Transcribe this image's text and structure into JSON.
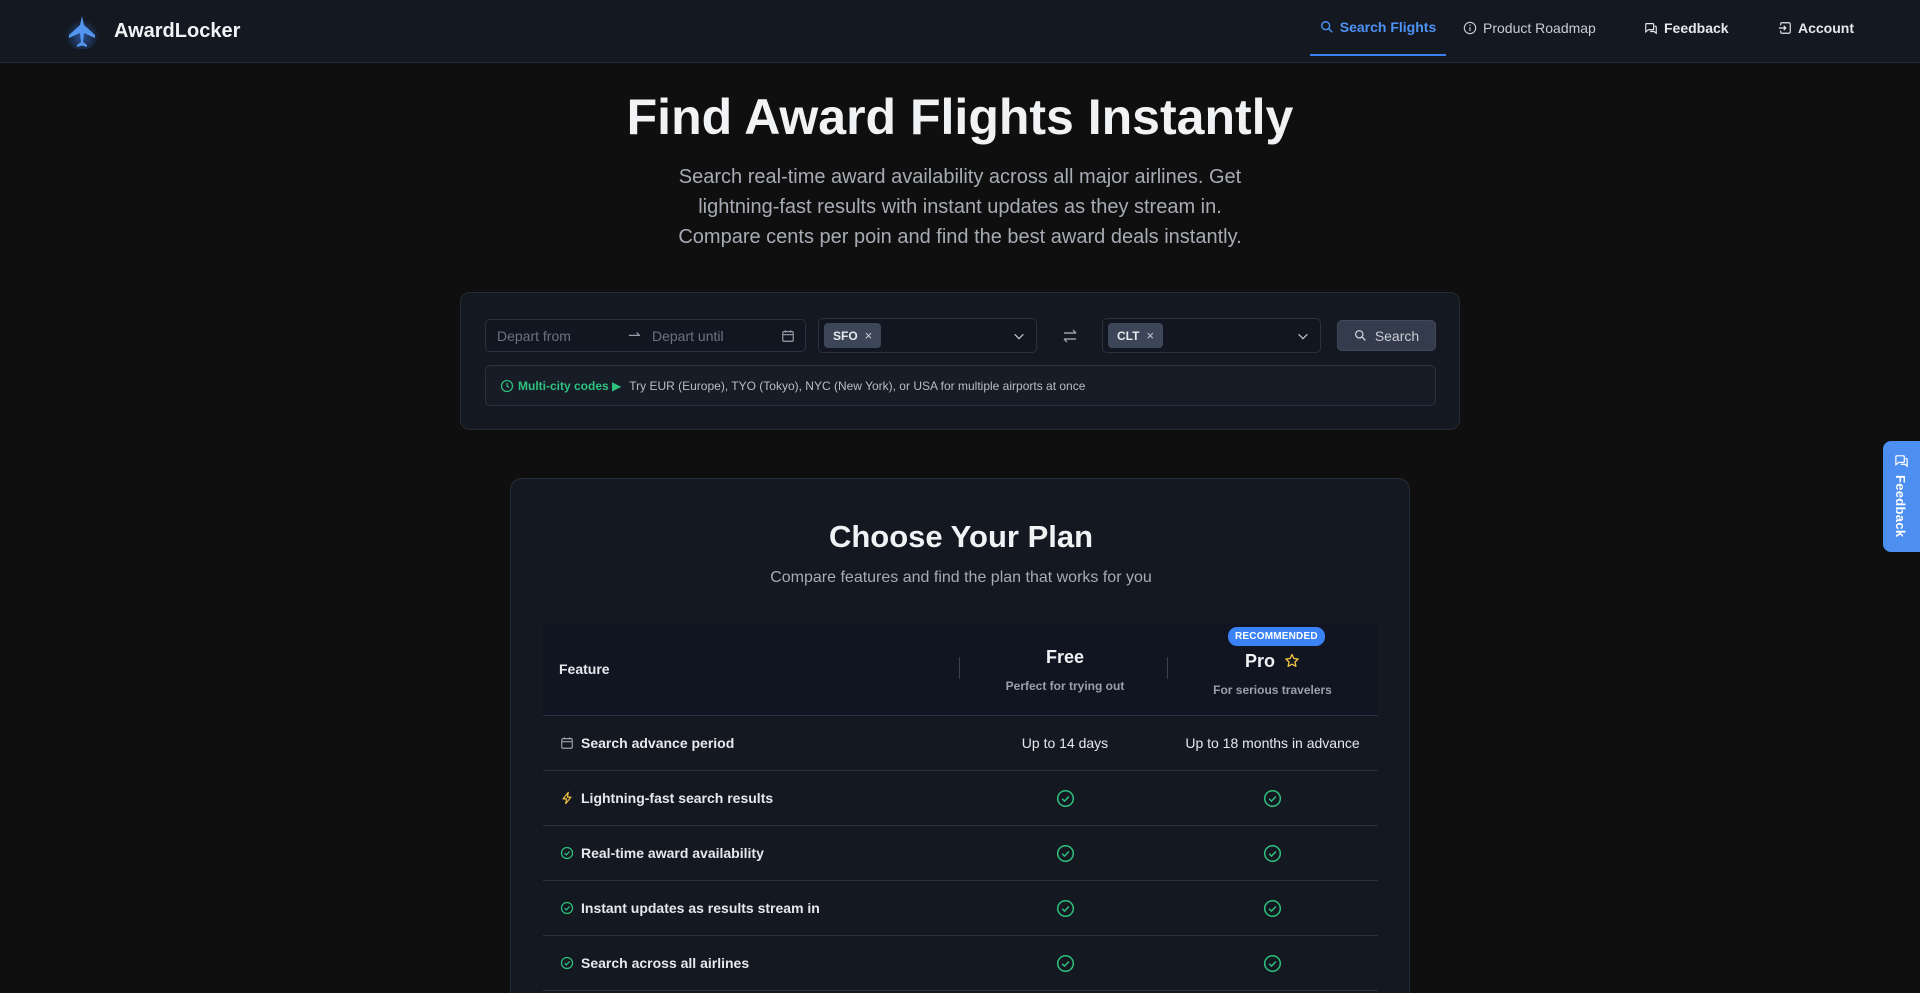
{
  "brand": {
    "name": "AwardLocker"
  },
  "nav": {
    "search_flights": "Search Flights",
    "product_roadmap": "Product Roadmap",
    "feedback": "Feedback",
    "account": "Account"
  },
  "hero": {
    "title": "Find Award Flights Instantly",
    "subtitle_line1": "Search real-time award availability across all major airlines. Get",
    "subtitle_line2": "lightning-fast results with instant updates as they stream in.",
    "subtitle_line3": "Compare cents per poin and find the best award deals instantly."
  },
  "search": {
    "depart_from_placeholder": "Depart from",
    "depart_until_placeholder": "Depart until",
    "origin_tag": "SFO",
    "destination_tag": "CLT",
    "tag_remove": "×",
    "button_label": "Search",
    "tip_lead": "Multi-city codes ▶",
    "tip_text": "Try EUR (Europe), TYO (Tokyo), NYC (New York), or USA for multiple airports at once"
  },
  "feedback_tab": {
    "label": "Feedback"
  },
  "plans": {
    "title": "Choose Your Plan",
    "subtitle": "Compare features and find the plan that works for you",
    "feature_header": "Feature",
    "free": {
      "name": "Free",
      "description": "Perfect for trying out"
    },
    "pro": {
      "name": "Pro",
      "description": "For serious travelers",
      "badge": "RECOMMENDED"
    },
    "rows": [
      {
        "feature": "Search advance period",
        "icon": "calendar-icon",
        "free": "Up to 14 days",
        "pro": "Up to 18 months in advance"
      },
      {
        "feature": "Lightning-fast search results",
        "icon": "lightning-icon",
        "free": "check",
        "pro": "check"
      },
      {
        "feature": "Real-time award availability",
        "icon": "check-circle-icon",
        "free": "check",
        "pro": "check"
      },
      {
        "feature": "Instant updates as results stream in",
        "icon": "check-circle-icon",
        "free": "check",
        "pro": "check"
      },
      {
        "feature": "Search across all airlines",
        "icon": "check-circle-icon",
        "free": "check",
        "pro": "check"
      }
    ]
  },
  "colors": {
    "background": "#0f0f10",
    "panel": "#141821",
    "accent": "#3b82f6",
    "success": "#2ec27e",
    "star": "#f5c542"
  }
}
